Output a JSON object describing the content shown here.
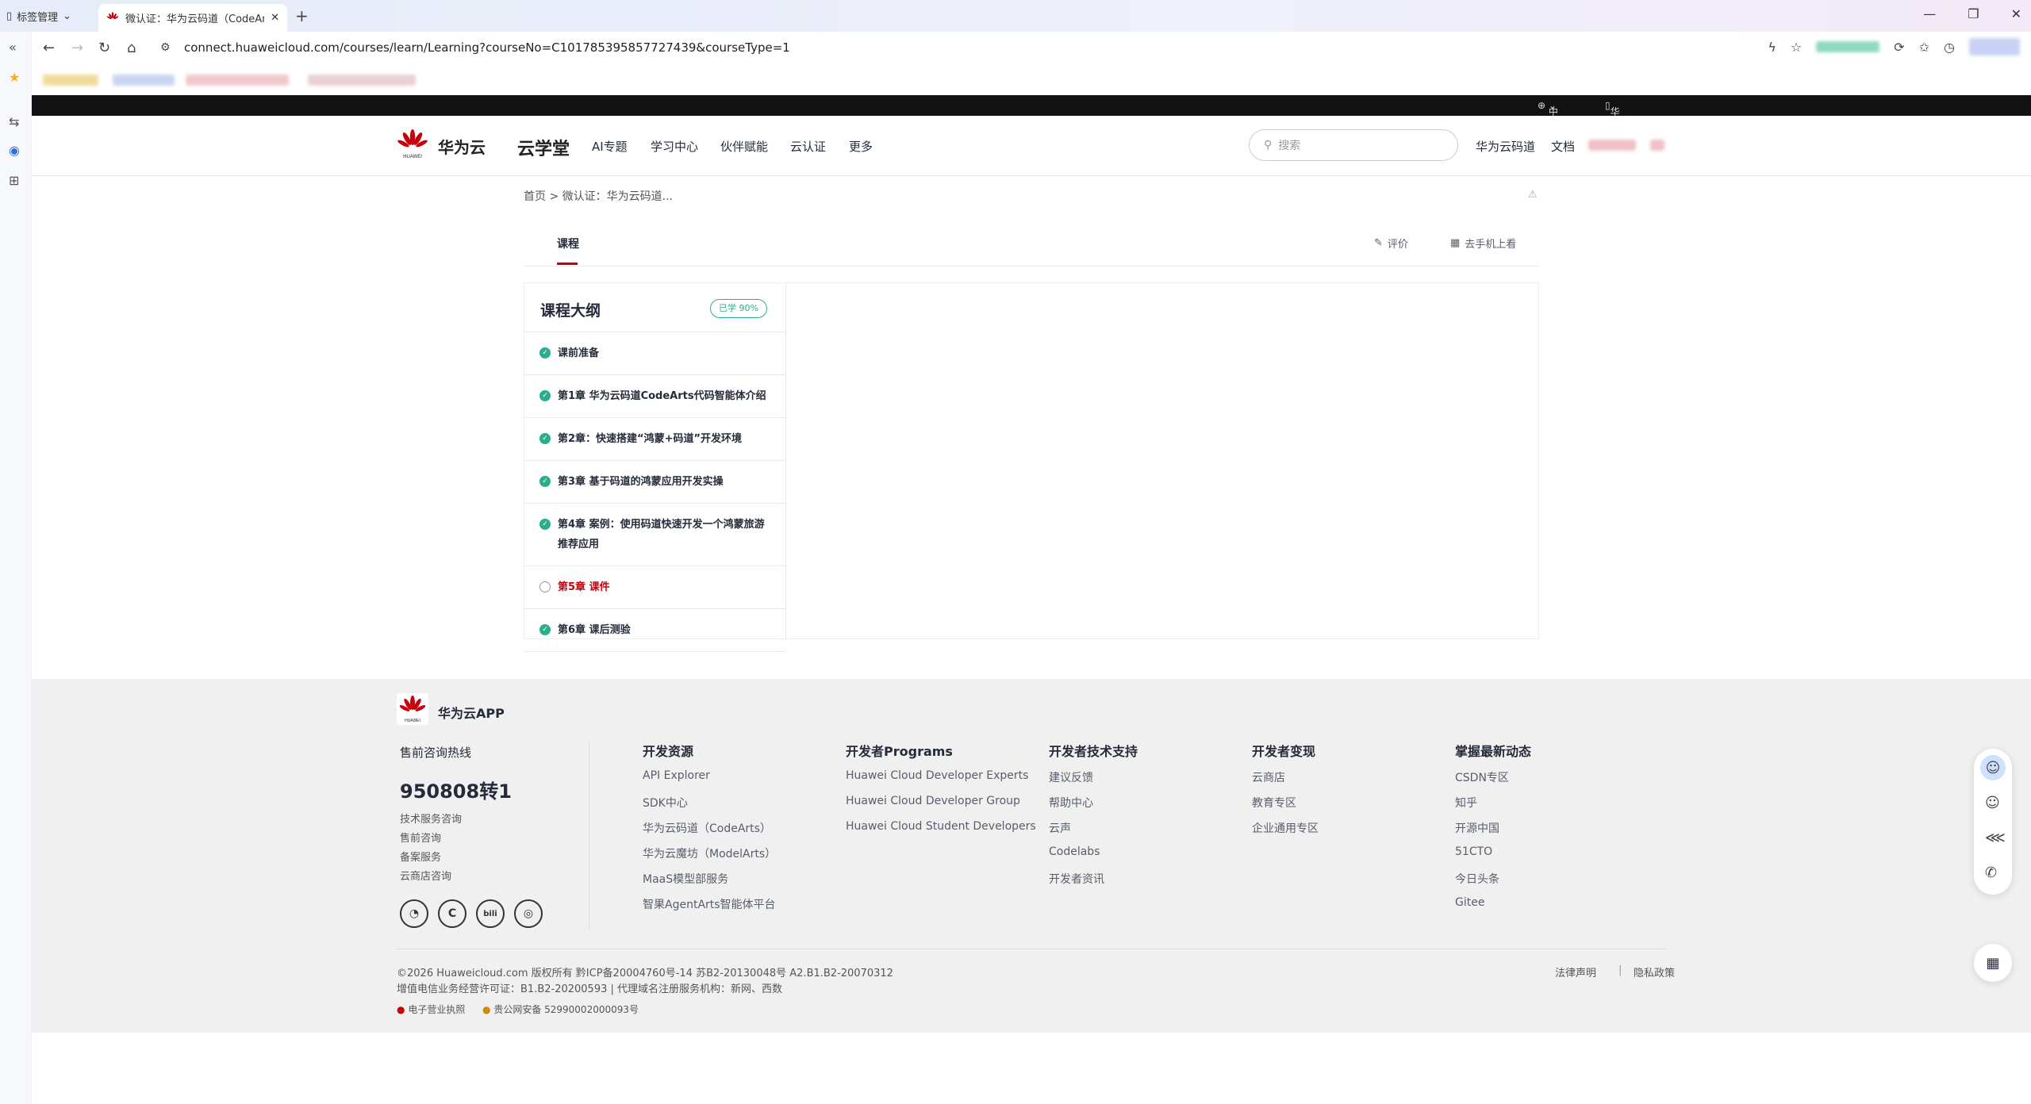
{
  "browser": {
    "tab_manager_label": "标签管理",
    "active_tab_title": "微认证：华为云码道（CodeArts）",
    "url": "connect.huaweicloud.com/courses/learn/Learning?courseNo=C101785395857727439&courseType=1"
  },
  "topstrip": {
    "region": "中国站",
    "app": "华为云App"
  },
  "header": {
    "brand": "华为云",
    "section": "云学堂",
    "nav": [
      "AI专题",
      "学习中心",
      "伙伴赋能",
      "云认证",
      "更多"
    ],
    "search_placeholder": "搜索",
    "links": [
      "华为云码道",
      "文档"
    ]
  },
  "breadcrumb": "首页 > 微认证：华为云码道...",
  "course_tabs": {
    "active": "课程",
    "actions": [
      "评价",
      "去手机上看"
    ]
  },
  "outline": {
    "title": "课程大纲",
    "progress_badge": "已学 90%",
    "chapters": [
      {
        "label": "课前准备",
        "done": true
      },
      {
        "label": "第1章 华为云码道CodeArts代码智能体介绍",
        "done": true
      },
      {
        "label": "第2章：快速搭建“鸿蒙+码道”开发环境",
        "done": true
      },
      {
        "label": "第3章 基于码道的鸿蒙应用开发实操",
        "done": true
      },
      {
        "label": "第4章 案例：使用码道快速开发一个鸿蒙旅游推荐应用",
        "done": true
      },
      {
        "label": "第5章 课件",
        "done": false
      },
      {
        "label": "第6章 课后测验",
        "done": true
      }
    ]
  },
  "footer": {
    "app_label": "华为云APP",
    "hotline_title": "售前咨询热线",
    "hotline": "950808转1",
    "contacts": [
      "技术服务咨询",
      "售前咨询",
      "备案服务",
      "云商店咨询"
    ],
    "social_icons": [
      "wechat-icon",
      "csdn-icon",
      "bilibili-icon",
      "weibo-icon"
    ],
    "columns": [
      {
        "title": "开发资源",
        "items": [
          "API Explorer",
          "SDK中心",
          "华为云码道（CodeArts）",
          "华为云魔坊（ModelArts）",
          "MaaS模型部服务",
          "智果AgentArts智能体平台"
        ]
      },
      {
        "title": "开发者Programs",
        "items": [
          "Huawei Cloud Developer Experts",
          "Huawei Cloud Developer Group",
          "Huawei Cloud Student Developers"
        ]
      },
      {
        "title": "开发者技术支持",
        "items": [
          "建议反馈",
          "帮助中心",
          "云声",
          "Codelabs",
          "开发者资讯"
        ]
      },
      {
        "title": "开发者变现",
        "items": [
          "云商店",
          "教育专区",
          "企业通用专区"
        ]
      },
      {
        "title": "掌握最新动态",
        "items": [
          "CSDN专区",
          "知乎",
          "开源中国",
          "51CTO",
          "今日头条",
          "Gitee"
        ]
      }
    ],
    "copyright": "©2026 Huaweicloud.com 版权所有  黔ICP备20004760号-14  苏B2-20130048号  A2.B1.B2-20070312",
    "license": "增值电信业务经营许可证：B1.B2-20200593 | 代理域名注册服务机构：新网、西数",
    "badges": [
      "电子营业执照",
      "贵公网安备 52990002000093号"
    ],
    "legal_links": [
      "法律声明",
      "隐私政策"
    ]
  }
}
